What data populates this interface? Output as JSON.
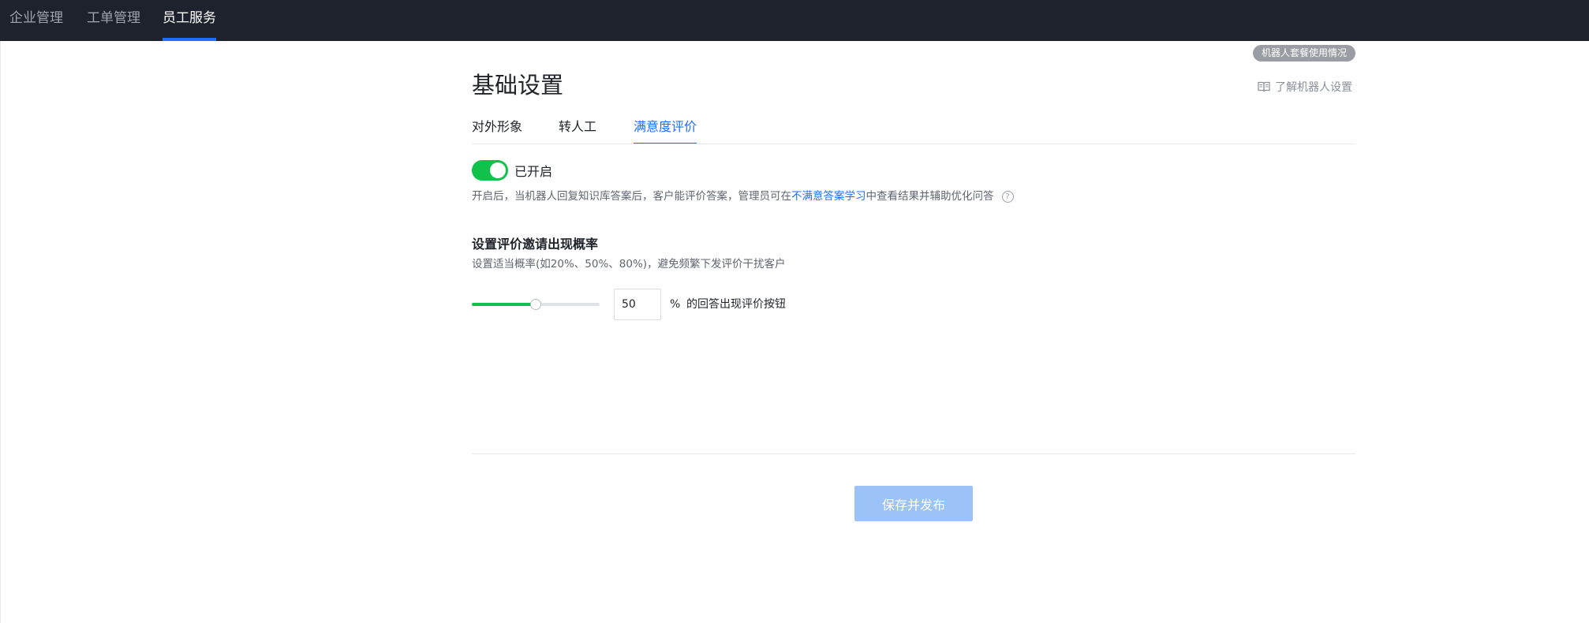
{
  "nav": {
    "items": [
      {
        "label": "企业管理",
        "active": false
      },
      {
        "label": "工单管理",
        "active": false
      },
      {
        "label": "员工服务",
        "active": true
      }
    ]
  },
  "header": {
    "usage_badge": "机器人套餐使用情况",
    "title": "基础设置",
    "learn_link": "了解机器人设置",
    "learn_icon": "book-icon"
  },
  "tabs": [
    {
      "label": "对外形象",
      "active": false
    },
    {
      "label": "转人工",
      "active": false
    },
    {
      "label": "满意度评价",
      "active": true
    }
  ],
  "satisfaction": {
    "toggle_on": true,
    "toggle_label": "已开启",
    "description_before": "开启后，当机器人回复知识库答案后，客户能评价答案，管理员可在",
    "description_link": "不满意答案学习",
    "description_after": "中查看结果并辅助优化问答",
    "help_icon": "question-circle-icon",
    "help_glyph": "?"
  },
  "probability": {
    "title": "设置评价邀请出现概率",
    "subtitle": "设置适当概率(如20%、50%、80%)，避免频繁下发评价干扰客户",
    "value": "50",
    "slider_percent": 50,
    "unit": "%",
    "suffix": "的回答出现评价按钮"
  },
  "footer": {
    "save_label": "保存并发布"
  },
  "colors": {
    "topbar_bg": "#1d222c",
    "accent": "#1e6fff",
    "toggle_on": "#11c24a",
    "save_button_disabled": "#9cc3f7"
  }
}
